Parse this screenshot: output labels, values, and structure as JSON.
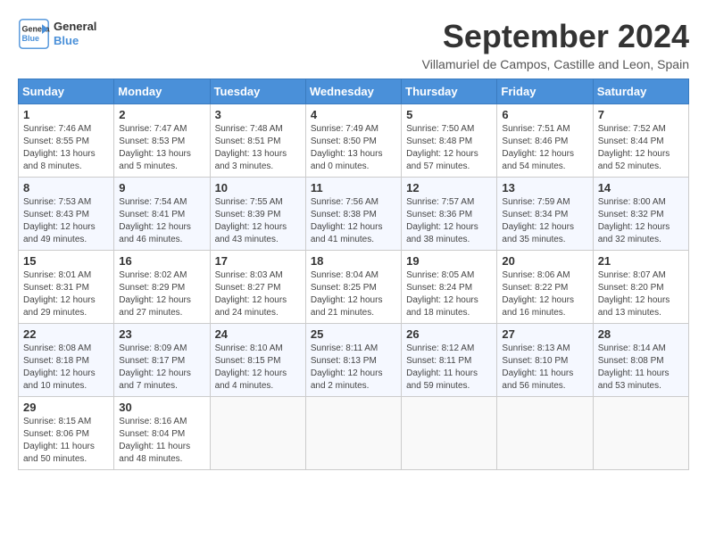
{
  "logo": {
    "line1": "General",
    "line2": "Blue"
  },
  "title": "September 2024",
  "subtitle": "Villamuriel de Campos, Castille and Leon, Spain",
  "days_of_week": [
    "Sunday",
    "Monday",
    "Tuesday",
    "Wednesday",
    "Thursday",
    "Friday",
    "Saturday"
  ],
  "weeks": [
    [
      {
        "day": 1,
        "info": "Sunrise: 7:46 AM\nSunset: 8:55 PM\nDaylight: 13 hours\nand 8 minutes."
      },
      {
        "day": 2,
        "info": "Sunrise: 7:47 AM\nSunset: 8:53 PM\nDaylight: 13 hours\nand 5 minutes."
      },
      {
        "day": 3,
        "info": "Sunrise: 7:48 AM\nSunset: 8:51 PM\nDaylight: 13 hours\nand 3 minutes."
      },
      {
        "day": 4,
        "info": "Sunrise: 7:49 AM\nSunset: 8:50 PM\nDaylight: 13 hours\nand 0 minutes."
      },
      {
        "day": 5,
        "info": "Sunrise: 7:50 AM\nSunset: 8:48 PM\nDaylight: 12 hours\nand 57 minutes."
      },
      {
        "day": 6,
        "info": "Sunrise: 7:51 AM\nSunset: 8:46 PM\nDaylight: 12 hours\nand 54 minutes."
      },
      {
        "day": 7,
        "info": "Sunrise: 7:52 AM\nSunset: 8:44 PM\nDaylight: 12 hours\nand 52 minutes."
      }
    ],
    [
      {
        "day": 8,
        "info": "Sunrise: 7:53 AM\nSunset: 8:43 PM\nDaylight: 12 hours\nand 49 minutes."
      },
      {
        "day": 9,
        "info": "Sunrise: 7:54 AM\nSunset: 8:41 PM\nDaylight: 12 hours\nand 46 minutes."
      },
      {
        "day": 10,
        "info": "Sunrise: 7:55 AM\nSunset: 8:39 PM\nDaylight: 12 hours\nand 43 minutes."
      },
      {
        "day": 11,
        "info": "Sunrise: 7:56 AM\nSunset: 8:38 PM\nDaylight: 12 hours\nand 41 minutes."
      },
      {
        "day": 12,
        "info": "Sunrise: 7:57 AM\nSunset: 8:36 PM\nDaylight: 12 hours\nand 38 minutes."
      },
      {
        "day": 13,
        "info": "Sunrise: 7:59 AM\nSunset: 8:34 PM\nDaylight: 12 hours\nand 35 minutes."
      },
      {
        "day": 14,
        "info": "Sunrise: 8:00 AM\nSunset: 8:32 PM\nDaylight: 12 hours\nand 32 minutes."
      }
    ],
    [
      {
        "day": 15,
        "info": "Sunrise: 8:01 AM\nSunset: 8:31 PM\nDaylight: 12 hours\nand 29 minutes."
      },
      {
        "day": 16,
        "info": "Sunrise: 8:02 AM\nSunset: 8:29 PM\nDaylight: 12 hours\nand 27 minutes."
      },
      {
        "day": 17,
        "info": "Sunrise: 8:03 AM\nSunset: 8:27 PM\nDaylight: 12 hours\nand 24 minutes."
      },
      {
        "day": 18,
        "info": "Sunrise: 8:04 AM\nSunset: 8:25 PM\nDaylight: 12 hours\nand 21 minutes."
      },
      {
        "day": 19,
        "info": "Sunrise: 8:05 AM\nSunset: 8:24 PM\nDaylight: 12 hours\nand 18 minutes."
      },
      {
        "day": 20,
        "info": "Sunrise: 8:06 AM\nSunset: 8:22 PM\nDaylight: 12 hours\nand 16 minutes."
      },
      {
        "day": 21,
        "info": "Sunrise: 8:07 AM\nSunset: 8:20 PM\nDaylight: 12 hours\nand 13 minutes."
      }
    ],
    [
      {
        "day": 22,
        "info": "Sunrise: 8:08 AM\nSunset: 8:18 PM\nDaylight: 12 hours\nand 10 minutes."
      },
      {
        "day": 23,
        "info": "Sunrise: 8:09 AM\nSunset: 8:17 PM\nDaylight: 12 hours\nand 7 minutes."
      },
      {
        "day": 24,
        "info": "Sunrise: 8:10 AM\nSunset: 8:15 PM\nDaylight: 12 hours\nand 4 minutes."
      },
      {
        "day": 25,
        "info": "Sunrise: 8:11 AM\nSunset: 8:13 PM\nDaylight: 12 hours\nand 2 minutes."
      },
      {
        "day": 26,
        "info": "Sunrise: 8:12 AM\nSunset: 8:11 PM\nDaylight: 11 hours\nand 59 minutes."
      },
      {
        "day": 27,
        "info": "Sunrise: 8:13 AM\nSunset: 8:10 PM\nDaylight: 11 hours\nand 56 minutes."
      },
      {
        "day": 28,
        "info": "Sunrise: 8:14 AM\nSunset: 8:08 PM\nDaylight: 11 hours\nand 53 minutes."
      }
    ],
    [
      {
        "day": 29,
        "info": "Sunrise: 8:15 AM\nSunset: 8:06 PM\nDaylight: 11 hours\nand 50 minutes."
      },
      {
        "day": 30,
        "info": "Sunrise: 8:16 AM\nSunset: 8:04 PM\nDaylight: 11 hours\nand 48 minutes."
      },
      null,
      null,
      null,
      null,
      null
    ]
  ]
}
